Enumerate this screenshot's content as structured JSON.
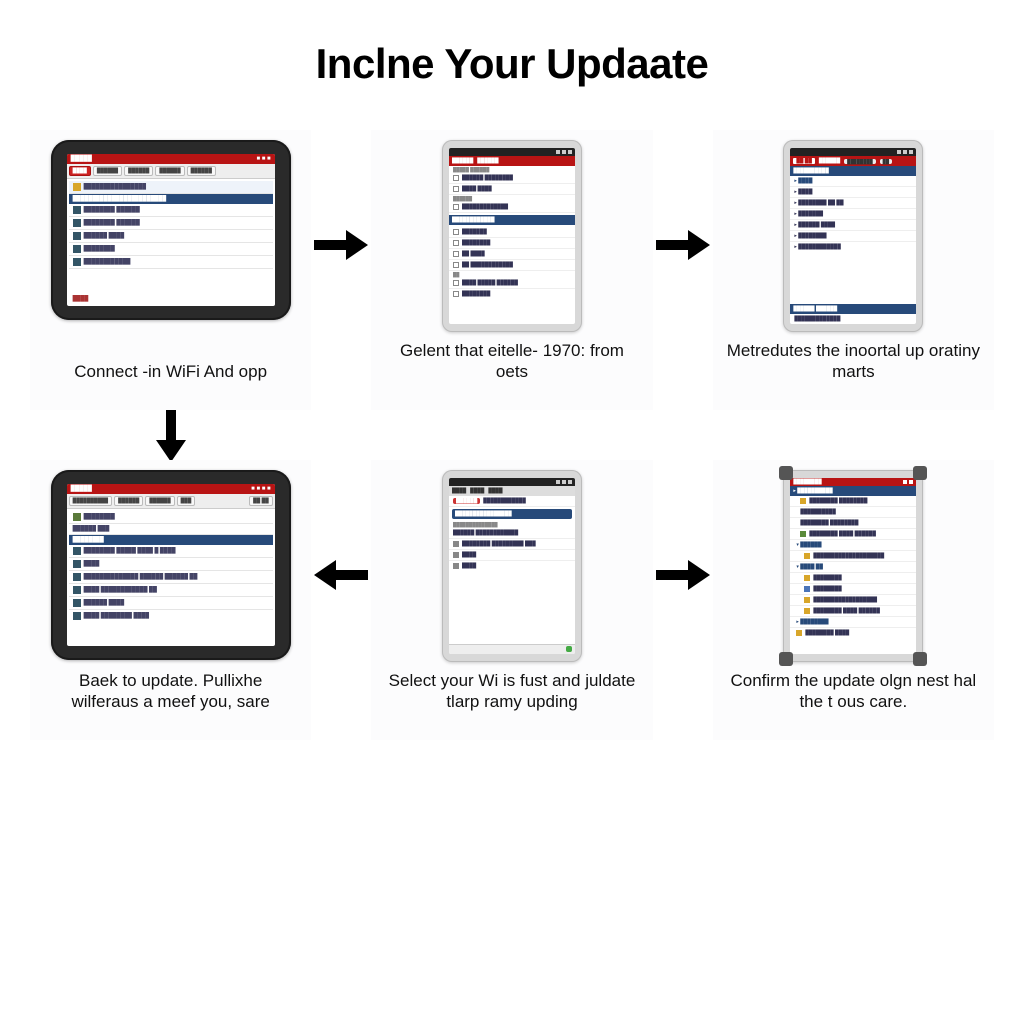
{
  "title": "Inclne Your Updaate",
  "steps": [
    {
      "caption": "Connect -in WiFi And opp"
    },
    {
      "caption": "Gelent that eitelle- 1970: from oets"
    },
    {
      "caption": "Metredutes the inoortal up oratiny marts"
    },
    {
      "caption": "Baek to update. Pullixhe wilferaus a meef you, sare"
    },
    {
      "caption": "Select your Wi is fust and juldate tlarp ramy upding"
    },
    {
      "caption": "Confirm the update olgn nest hal the t ous care."
    }
  ],
  "colors": {
    "accent_red": "#b81414",
    "accent_blue": "#274a7a"
  }
}
